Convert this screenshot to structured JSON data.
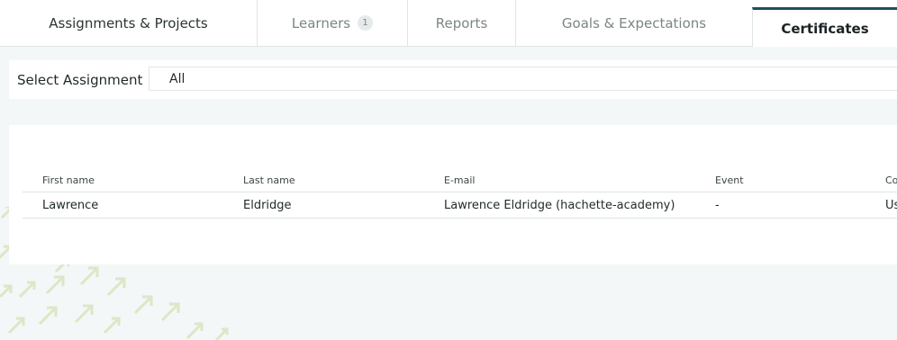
{
  "tabs": [
    {
      "label": "Assignments & Projects"
    },
    {
      "label": "Learners",
      "badge": "1"
    },
    {
      "label": "Reports"
    },
    {
      "label": "Goals & Expectations"
    },
    {
      "label": "Certificates",
      "active": true
    }
  ],
  "filter": {
    "label": "Select Assignment",
    "value": "All"
  },
  "table": {
    "columns": [
      "First name",
      "Last name",
      "E-mail",
      "Event",
      "Co"
    ],
    "rows": [
      {
        "first_name": "Lawrence",
        "last_name": "Eldridge",
        "email": "Lawrence Eldridge (hachette-academy)",
        "event": "-",
        "col5": "Us"
      }
    ]
  },
  "colors": {
    "accent": "#1f4f5c",
    "background": "#f3f7f7",
    "decor": "#dfe8c8"
  }
}
